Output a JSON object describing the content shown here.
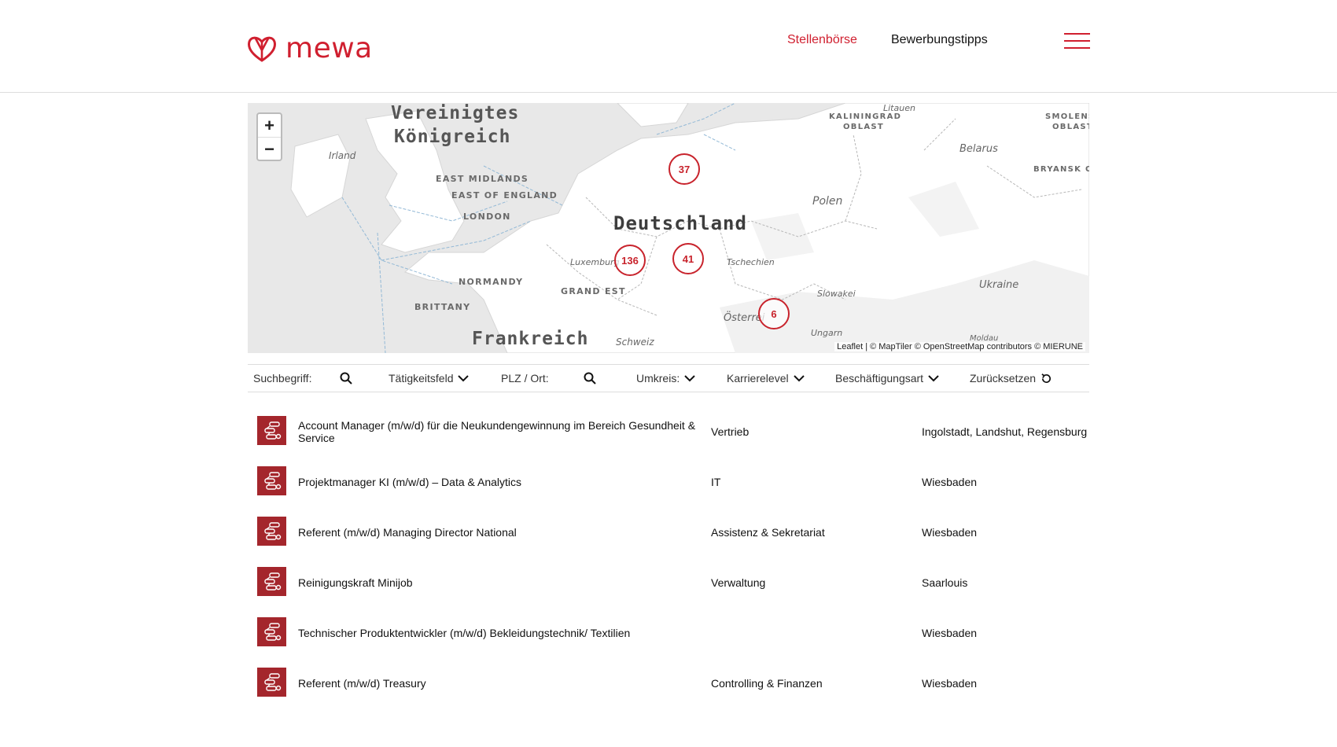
{
  "header": {
    "logo_text": "mewa",
    "nav": [
      {
        "label": "Stellenbörse",
        "active": true
      },
      {
        "label": "Bewerbungstipps",
        "active": false
      }
    ]
  },
  "map": {
    "countries": {
      "uk_line1": "Vereinigtes",
      "uk_line2": "Königreich",
      "germany": "Deutschland",
      "france": "Frankreich"
    },
    "regions": {
      "east_midlands": "EAST MIDLANDS",
      "east_of_england": "EAST OF ENGLAND",
      "london": "LONDON",
      "normandy": "NORMANDY",
      "brittany": "BRITTANY",
      "grand_est": "GRAND EST",
      "kaliningrad1": "KALININGRAD",
      "kaliningrad2": "OBLAST",
      "smolensk1": "SMOLENS",
      "smolensk2": "OBLAST",
      "bryansk": "BRYANSK OI"
    },
    "places": {
      "irland": "Irland",
      "luxemburg": "Luxemburg",
      "polen": "Polen",
      "belarus": "Belarus",
      "litauen": "Litauen",
      "tschechien": "Tschechien",
      "slowakei": "Slowakei",
      "ukraine": "Ukraine",
      "oesterreich": "Österrei",
      "ungarn": "Ungarn",
      "schweiz": "Schweiz",
      "moldau": "Moldau"
    },
    "clusters": [
      "37",
      "136",
      "41",
      "6"
    ],
    "zoom_in": "+",
    "zoom_out": "−",
    "attribution": "Leaflet | © MapTiler © OpenStreetMap contributors © MIERUNE",
    "colors": {
      "cluster": "#c8232c",
      "land": "#ffffff",
      "water": "#e8e8e8"
    }
  },
  "filters": {
    "search_label": "Suchbegriff:",
    "taetigkeitsfeld": "Tätigkeitsfeld",
    "plz_label": "PLZ / Ort:",
    "umkreis": "Umkreis:",
    "karrierelevel": "Karrierelevel",
    "beschaeftigungsart": "Beschäftigungsart",
    "reset": "Zurücksetzen"
  },
  "jobs": [
    {
      "title": "Account Manager (m/w/d) für die Neukundengewinnung im Bereich Gesundheit & Service",
      "category": "Vertrieb",
      "location": "Ingolstadt, Landshut, Regensburg"
    },
    {
      "title": "Projektmanager KI (m/w/d) – Data & Analytics",
      "category": "IT",
      "location": "Wiesbaden"
    },
    {
      "title": "Referent (m/w/d) Managing Director National",
      "category": "Assistenz & Sekretariat",
      "location": "Wiesbaden"
    },
    {
      "title": "Reinigungskraft Minijob",
      "category": "Verwaltung",
      "location": "Saarlouis"
    },
    {
      "title": "Technischer Produktentwickler (m/w/d) Bekleidungstechnik/ Textilien",
      "category": "",
      "location": "Wiesbaden"
    },
    {
      "title": "Referent (m/w/d) Treasury",
      "category": "Controlling & Finanzen",
      "location": "Wiesbaden"
    }
  ],
  "brand_color": "#d01f2f"
}
